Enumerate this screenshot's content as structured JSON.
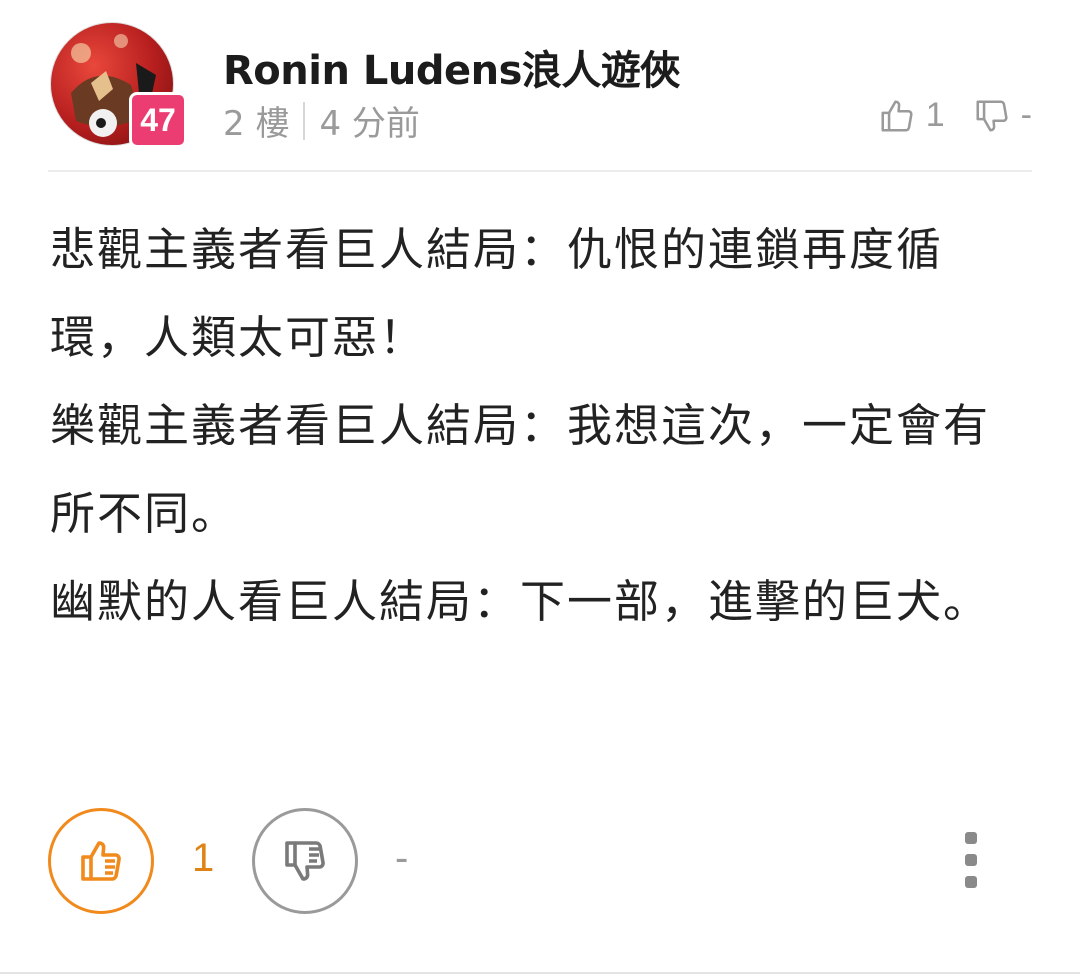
{
  "post": {
    "author": "Ronin Ludens浪人遊俠",
    "level": "47",
    "floor": "2 樓",
    "time": "4 分前",
    "likes": "1",
    "dislikes": "-",
    "content_lines": [
      "悲觀主義者看巨人結局：仇恨的連鎖再度循環，人類太可惡！",
      "樂觀主義者看巨人結局：我想這次，一定會有所不同。",
      "幽默的人看巨人結局：下一部，進擊的巨犬。"
    ]
  },
  "actions": {
    "like_count": "1",
    "dislike_count": "-"
  },
  "colors": {
    "accent": "#f08a1c",
    "level_badge": "#ec3d72",
    "muted": "#9a9a9a"
  },
  "icons": {
    "like": "thumbs-up-icon",
    "dislike": "thumbs-down-icon",
    "more": "more-vertical-icon"
  }
}
